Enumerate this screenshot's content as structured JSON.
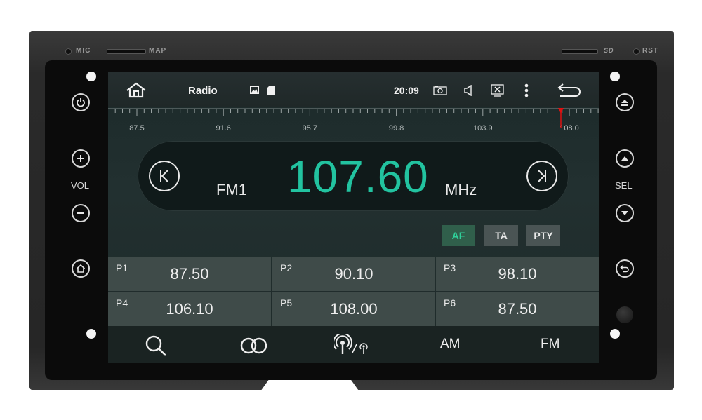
{
  "bezel": {
    "mic_label": "MIC",
    "map_label": "MAP",
    "rst_label": "RST",
    "sd_label": "SD",
    "vol_label": "VOL",
    "sel_label": "SEL",
    "left_buttons": [
      "power-icon",
      "plus-icon",
      "minus-icon",
      "home-icon"
    ],
    "right_buttons": [
      "eject-icon",
      "up-icon",
      "down-icon",
      "back-icon"
    ]
  },
  "statusbar": {
    "home_icon": "home-icon",
    "title": "Radio",
    "notif_icons": [
      "image-icon",
      "sd-card-icon"
    ],
    "time": "20:09",
    "icons": [
      "camera-icon",
      "volume-icon",
      "close-box-icon",
      "more-vert-icon",
      "back-arrow-icon"
    ]
  },
  "tuner": {
    "scale_labels": [
      "87.5",
      "91.6",
      "95.7",
      "99.8",
      "103.9",
      "108.0"
    ],
    "band": "FM1",
    "frequency": "107.60",
    "unit": "MHz",
    "prev_icon": "seek-prev-icon",
    "next_icon": "seek-next-icon",
    "needle_color": "#e01010",
    "accent": "#22c3a0"
  },
  "options": {
    "af": "AF",
    "ta": "TA",
    "pty": "PTY"
  },
  "presets": [
    {
      "name": "P1",
      "freq": "87.50"
    },
    {
      "name": "P2",
      "freq": "90.10"
    },
    {
      "name": "P3",
      "freq": "98.10"
    },
    {
      "name": "P4",
      "freq": "106.10"
    },
    {
      "name": "P5",
      "freq": "108.00"
    },
    {
      "name": "P6",
      "freq": "87.50"
    }
  ],
  "bottombar": {
    "search_icon": "search-icon",
    "stereo_icon": "stereo-icon",
    "antenna_icon": "antenna-icon",
    "am": "AM",
    "fm": "FM"
  }
}
